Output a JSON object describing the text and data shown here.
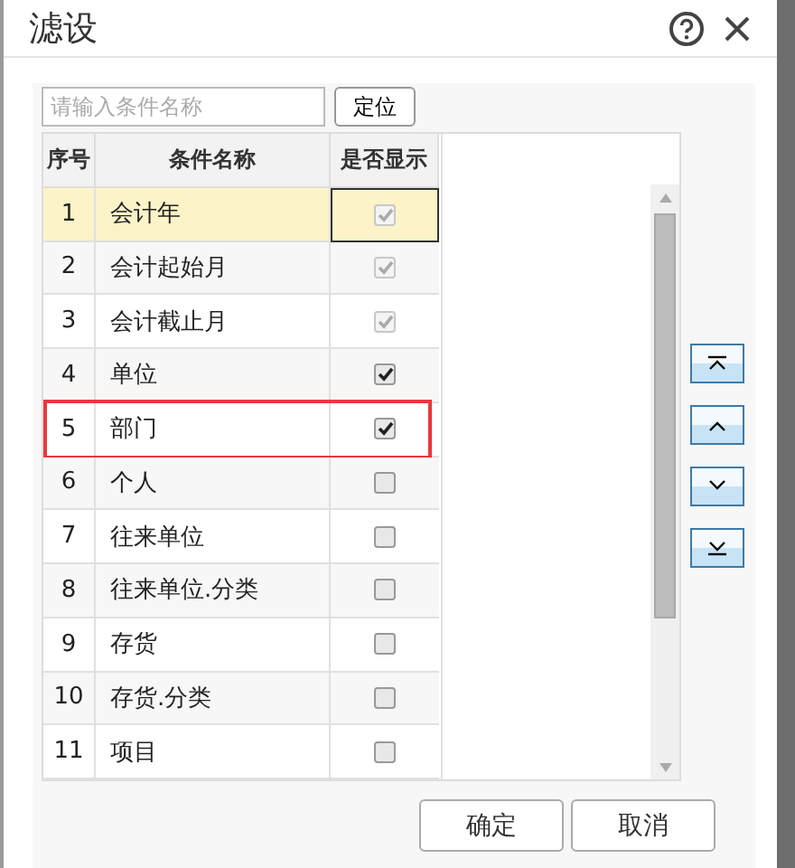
{
  "window": {
    "title": "滤设"
  },
  "search": {
    "placeholder": "请输入条件名称",
    "button": "定位"
  },
  "table": {
    "columns": [
      "序号",
      "条件名称",
      "是否显示"
    ],
    "rows": [
      {
        "index": "1",
        "name": "会计年",
        "checked": true,
        "disabled": true,
        "selected": true,
        "highlighted": false
      },
      {
        "index": "2",
        "name": "会计起始月",
        "checked": true,
        "disabled": true,
        "selected": false,
        "highlighted": false
      },
      {
        "index": "3",
        "name": "会计截止月",
        "checked": true,
        "disabled": true,
        "selected": false,
        "highlighted": false
      },
      {
        "index": "4",
        "name": "单位",
        "checked": true,
        "disabled": false,
        "selected": false,
        "highlighted": false
      },
      {
        "index": "5",
        "name": "部门",
        "checked": true,
        "disabled": false,
        "selected": false,
        "highlighted": true
      },
      {
        "index": "6",
        "name": "个人",
        "checked": false,
        "disabled": false,
        "selected": false,
        "highlighted": false
      },
      {
        "index": "7",
        "name": "往来单位",
        "checked": false,
        "disabled": false,
        "selected": false,
        "highlighted": false
      },
      {
        "index": "8",
        "name": "往来单位.分类",
        "checked": false,
        "disabled": false,
        "selected": false,
        "highlighted": false
      },
      {
        "index": "9",
        "name": "存货",
        "checked": false,
        "disabled": false,
        "selected": false,
        "highlighted": false
      },
      {
        "index": "10",
        "name": "存货.分类",
        "checked": false,
        "disabled": false,
        "selected": false,
        "highlighted": false
      },
      {
        "index": "11",
        "name": "项目",
        "checked": false,
        "disabled": false,
        "selected": false,
        "highlighted": false
      }
    ]
  },
  "move_buttons": [
    {
      "kind": "top"
    },
    {
      "kind": "up"
    },
    {
      "kind": "down"
    },
    {
      "kind": "bottom"
    }
  ],
  "buttons": [
    "确定",
    "取消"
  ]
}
